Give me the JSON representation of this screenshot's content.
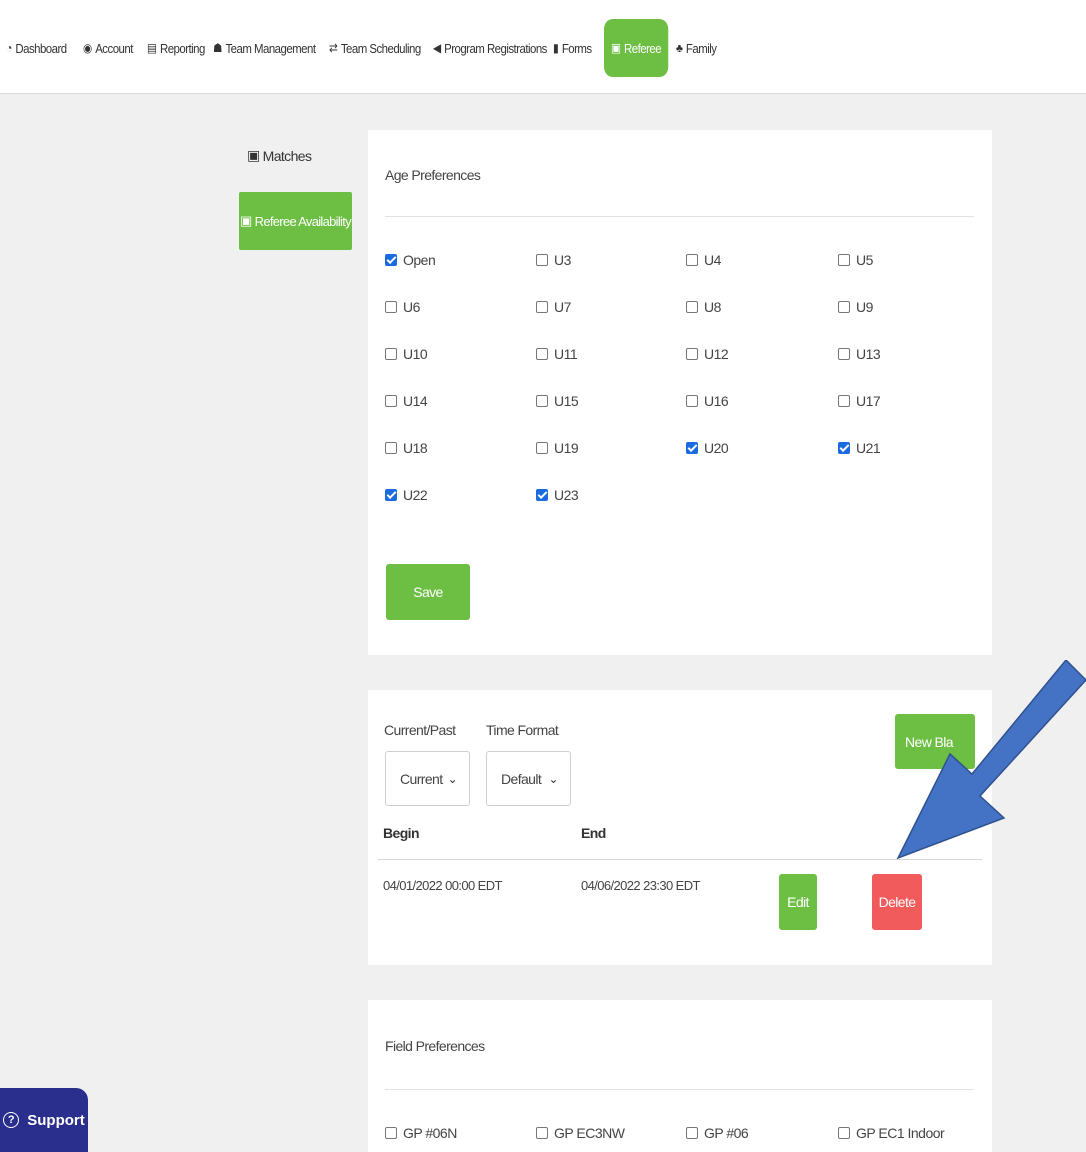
{
  "nav": {
    "items": [
      {
        "label": "Dashboard",
        "icon": "dashboard-icon"
      },
      {
        "label": "Account",
        "icon": "user-circle-icon"
      },
      {
        "label": "Reporting",
        "icon": "document-icon"
      },
      {
        "label": "Team Management",
        "icon": "users-icon"
      },
      {
        "label": "Team Scheduling",
        "icon": "exchange-icon"
      },
      {
        "label": "Program Registrations",
        "icon": "send-icon"
      },
      {
        "label": "Forms",
        "icon": "file-icon"
      },
      {
        "label": "Referee",
        "icon": "calendar-icon"
      },
      {
        "label": "Family",
        "icon": "family-icon"
      }
    ],
    "active": "Referee",
    "accent_color": "#6dbf44"
  },
  "sidebar": {
    "items": [
      {
        "label": "Matches",
        "icon": "calendar-icon"
      },
      {
        "label": "Referee Availability",
        "icon": "calendar-icon"
      }
    ],
    "active": "Referee Availability"
  },
  "age_preferences": {
    "title": "Age Preferences",
    "options": [
      {
        "label": "Open",
        "checked": true
      },
      {
        "label": "U3",
        "checked": false
      },
      {
        "label": "U4",
        "checked": false
      },
      {
        "label": "U5",
        "checked": false
      },
      {
        "label": "U6",
        "checked": false
      },
      {
        "label": "U7",
        "checked": false
      },
      {
        "label": "U8",
        "checked": false
      },
      {
        "label": "U9",
        "checked": false
      },
      {
        "label": "U10",
        "checked": false
      },
      {
        "label": "U11",
        "checked": false
      },
      {
        "label": "U12",
        "checked": false
      },
      {
        "label": "U13",
        "checked": false
      },
      {
        "label": "U14",
        "checked": false
      },
      {
        "label": "U15",
        "checked": false
      },
      {
        "label": "U16",
        "checked": false
      },
      {
        "label": "U17",
        "checked": false
      },
      {
        "label": "U18",
        "checked": false
      },
      {
        "label": "U19",
        "checked": false
      },
      {
        "label": "U20",
        "checked": true
      },
      {
        "label": "U21",
        "checked": true
      },
      {
        "label": "U22",
        "checked": true
      },
      {
        "label": "U23",
        "checked": true
      }
    ],
    "save_label": "Save"
  },
  "blackouts": {
    "current_past_label": "Current/Past",
    "current_past_value": "Current",
    "time_format_label": "Time Format",
    "time_format_value": "Default",
    "new_button_label": "New Bla",
    "columns": {
      "begin": "Begin",
      "end": "End"
    },
    "rows": [
      {
        "begin": "04/01/2022 00:00 EDT",
        "end": "04/06/2022 23:30 EDT",
        "edit_label": "Edit",
        "delete_label": "Delete"
      }
    ]
  },
  "field_preferences": {
    "title": "Field Preferences",
    "options": [
      {
        "label": "GP #06N",
        "checked": false
      },
      {
        "label": "GP EC3NW",
        "checked": false
      },
      {
        "label": "GP #06",
        "checked": false
      },
      {
        "label": "GP EC1 Indoor",
        "checked": false
      }
    ]
  },
  "support": {
    "label": "Support"
  },
  "annotation": {
    "arrow_color": "#4472c4"
  }
}
